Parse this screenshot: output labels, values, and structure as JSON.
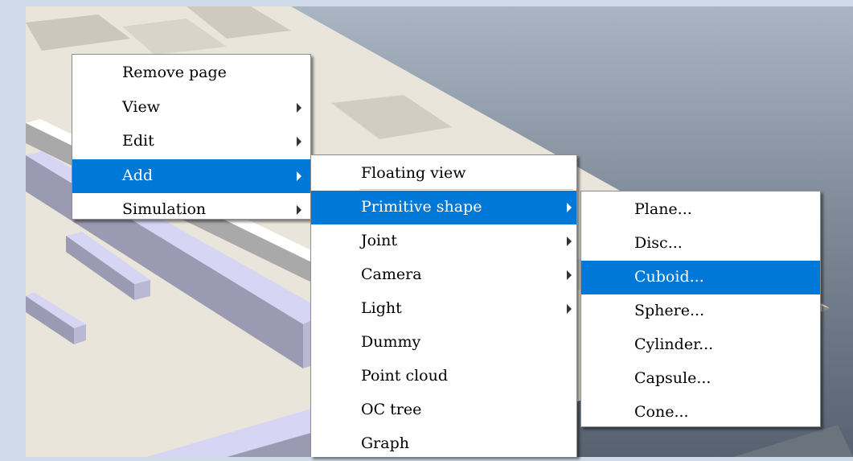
{
  "menus": {
    "main": [
      {
        "label": "Remove page",
        "submenu": false,
        "highlighted": false
      },
      {
        "label": "View",
        "submenu": true,
        "highlighted": false
      },
      {
        "label": "Edit",
        "submenu": true,
        "highlighted": false
      },
      {
        "label": "Add",
        "submenu": true,
        "highlighted": true
      },
      {
        "label": "Simulation",
        "submenu": true,
        "highlighted": false
      }
    ],
    "add": [
      {
        "label": "Floating view",
        "submenu": false,
        "highlighted": false
      },
      {
        "label": "Primitive shape",
        "submenu": true,
        "highlighted": true
      },
      {
        "label": "Joint",
        "submenu": true,
        "highlighted": false
      },
      {
        "label": "Camera",
        "submenu": true,
        "highlighted": false
      },
      {
        "label": "Light",
        "submenu": true,
        "highlighted": false
      },
      {
        "label": "Dummy",
        "submenu": false,
        "highlighted": false
      },
      {
        "label": "Point cloud",
        "submenu": false,
        "highlighted": false
      },
      {
        "label": "OC tree",
        "submenu": false,
        "highlighted": false
      },
      {
        "label": "Graph",
        "submenu": false,
        "highlighted": false
      }
    ],
    "primitive_shape": [
      {
        "label": "Plane...",
        "submenu": false,
        "highlighted": false
      },
      {
        "label": "Disc...",
        "submenu": false,
        "highlighted": false
      },
      {
        "label": "Cuboid...",
        "submenu": false,
        "highlighted": true
      },
      {
        "label": "Sphere...",
        "submenu": false,
        "highlighted": false
      },
      {
        "label": "Cylinder...",
        "submenu": false,
        "highlighted": false
      },
      {
        "label": "Capsule...",
        "submenu": false,
        "highlighted": false
      },
      {
        "label": "Cone...",
        "submenu": false,
        "highlighted": false
      }
    ]
  },
  "colors": {
    "highlight": "#0078d7",
    "page_background": "#cfdbe8",
    "floor_light": "#e9e5da",
    "floor_dark": "#c7c2b6",
    "block_face": "#d6d6f4",
    "block_side": "#9a9ab2"
  }
}
